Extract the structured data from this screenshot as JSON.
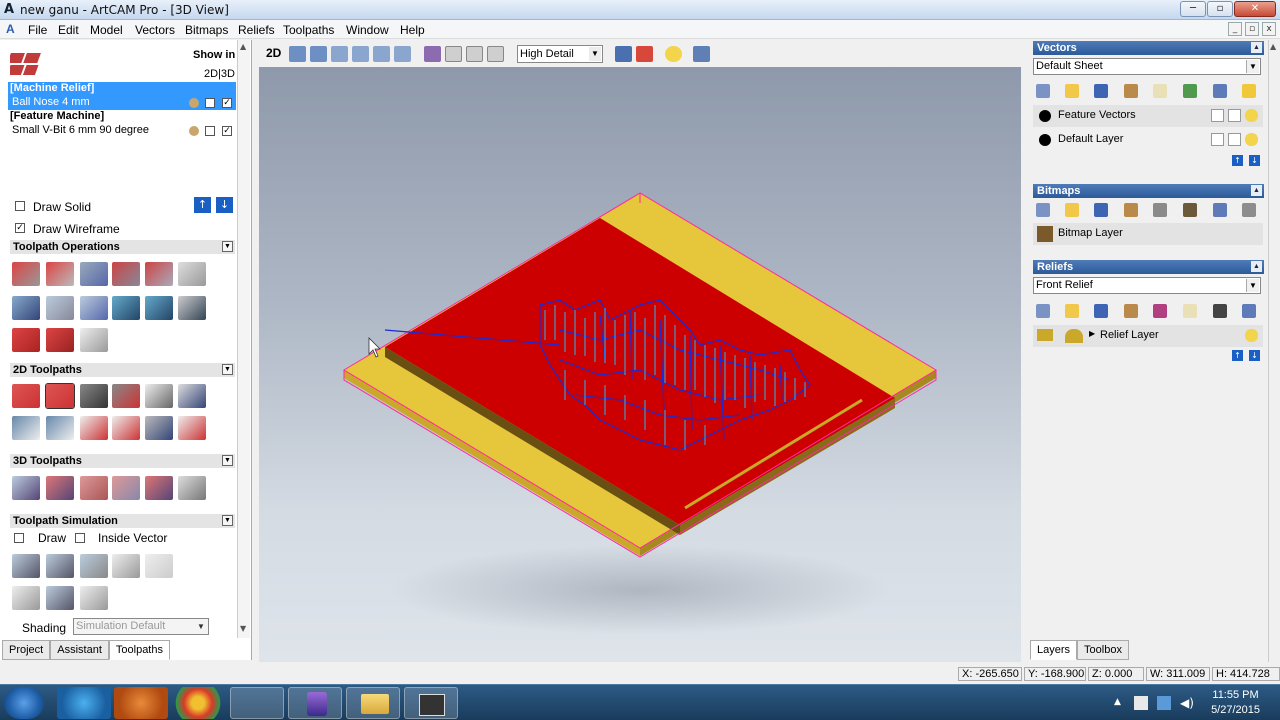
{
  "window": {
    "icon": "artcam-app-icon",
    "title": "new ganu - ArtCAM Pro - [3D View]"
  },
  "menu": [
    "File",
    "Edit",
    "Model",
    "Vectors",
    "Bitmaps",
    "Reliefs",
    "Toolpaths",
    "Window",
    "Help"
  ],
  "left": {
    "show_in": "Show in",
    "show_in_modes": "2D|3D",
    "toolpaths": [
      {
        "group": "[Machine Relief]",
        "tool": "Ball Nose 4 mm",
        "selected": true
      },
      {
        "group": "[Feature Machine]",
        "tool": "Small V-Bit 6 mm 90 degree",
        "selected": false
      }
    ],
    "draw_solid": "Draw Solid",
    "draw_wireframe": "Draw Wireframe",
    "sections": {
      "ops": "Toolpath Operations",
      "tp2d": "2D Toolpaths",
      "tp3d": "3D Toolpaths",
      "sim": "Toolpath Simulation"
    },
    "sim_draw": "Draw",
    "sim_inside": "Inside Vector",
    "shading_label": "Shading",
    "shading_value": "Simulation Default",
    "tabs": [
      "Project",
      "Assistant",
      "Toolpaths"
    ],
    "active_tab": "Toolpaths"
  },
  "view": {
    "mode_2d": "2D",
    "detail": "High Detail"
  },
  "right": {
    "vectors": {
      "title": "Vectors",
      "sheet": "Default Sheet",
      "layers": [
        "Feature Vectors",
        "Default Layer"
      ]
    },
    "bitmaps": {
      "title": "Bitmaps",
      "layer": "Bitmap Layer"
    },
    "reliefs": {
      "title": "Reliefs",
      "sheet": "Front Relief",
      "layer": "Relief Layer"
    },
    "tabs": [
      "Layers",
      "Toolbox"
    ],
    "active_tab": "Layers"
  },
  "status": {
    "x": "X: -265.650",
    "y": "Y: -168.900",
    "z": "Z: 0.000",
    "w": "W: 311.009",
    "h": "H: 414.728"
  },
  "taskbar": {
    "time": "11:55 PM",
    "date": "5/27/2015"
  },
  "colors": {
    "relief": "#cc0000",
    "material": "#e6c63a",
    "toolpath": "#1b2bd4",
    "header": "#2c5a9a",
    "selection": "#3399ff"
  }
}
